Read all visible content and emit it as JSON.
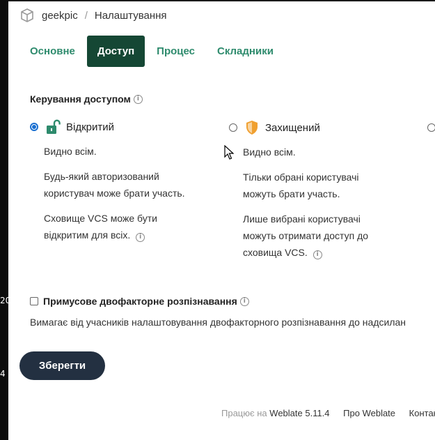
{
  "breadcrumb": {
    "project": "geekpic",
    "separator": "/",
    "page": "Налаштування"
  },
  "tabs": [
    {
      "label": "Основне",
      "active": false
    },
    {
      "label": "Доступ",
      "active": true
    },
    {
      "label": "Процес",
      "active": false
    },
    {
      "label": "Складники",
      "active": false
    }
  ],
  "access": {
    "title": "Керування доступом",
    "options": [
      {
        "label": "Відкритий",
        "selected": true,
        "icon": "lock-open-icon",
        "lines": [
          "Видно всім.",
          "Будь-який авторизований користувач може брати участь.",
          "Сховище VCS може бути відкритим для всіх."
        ]
      },
      {
        "label": "Захищений",
        "selected": false,
        "icon": "shield-icon",
        "lines": [
          "Видно всім.",
          "Тільки обрані користувачі можуть брати участь.",
          "Лише вибрані користувачі можуть отримати доступ до сховища VCS."
        ]
      }
    ]
  },
  "twofa": {
    "label": "Примусове двофакторне розпізнавання",
    "checked": false,
    "description": "Вимагає від учасників налаштовування двофакторного розпізнавання до надсилан"
  },
  "save_label": "Зберегти",
  "footer": {
    "powered": "Працює на",
    "version": "Weblate 5.11.4",
    "about": "Про Weblate",
    "contact": "Контак"
  },
  "strip": {
    "a": "20",
    "b": "4"
  },
  "colors": {
    "accent": "#154734",
    "tab_text": "#2e8b6d",
    "button": "#233041",
    "shield": "#f0a030",
    "lock": "#2e8b6d"
  }
}
